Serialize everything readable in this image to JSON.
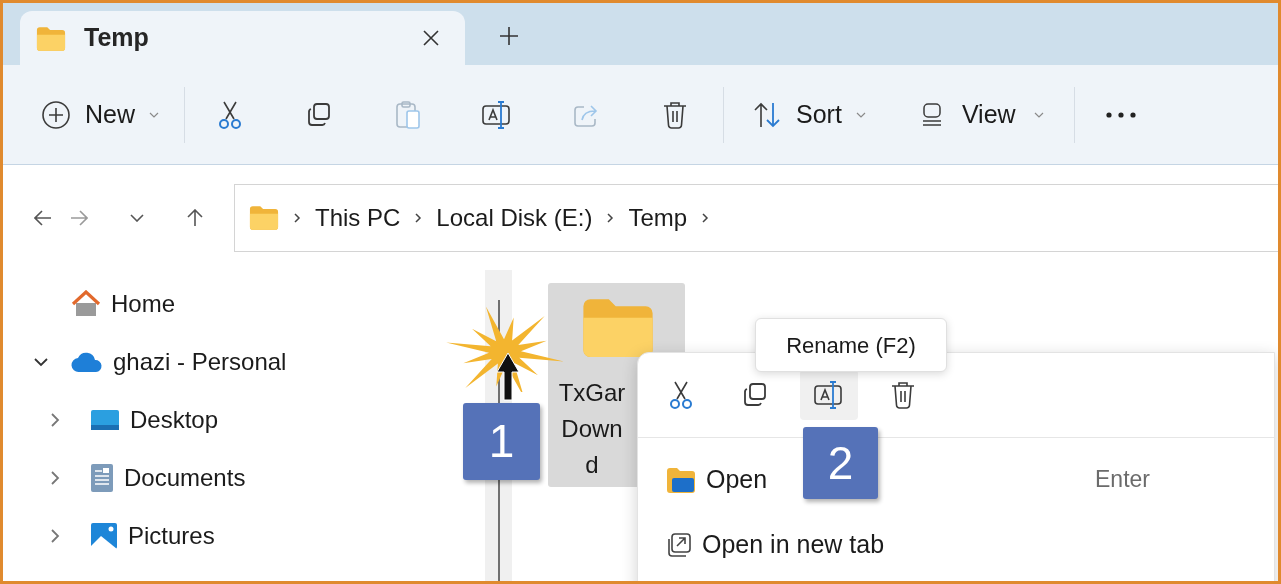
{
  "tabs": [
    {
      "label": "Temp",
      "selected": true
    }
  ],
  "toolbar": {
    "new_button": {
      "label": "New"
    },
    "icon_buttons": [
      {
        "kind": "cut",
        "disabled": false
      },
      {
        "kind": "copy",
        "disabled": false
      },
      {
        "kind": "paste",
        "disabled": true
      },
      {
        "kind": "rename",
        "disabled": false
      },
      {
        "kind": "share",
        "disabled": true
      },
      {
        "kind": "delete",
        "disabled": false
      }
    ],
    "sort_button": {
      "label": "Sort"
    },
    "view_button": {
      "label": "View"
    }
  },
  "address_bar": {
    "segments": [
      "This PC",
      "Local Disk (E:)",
      "Temp"
    ]
  },
  "nav_pane": {
    "items": [
      {
        "kind": "home",
        "label": "Home"
      },
      {
        "kind": "cloud",
        "label": "ghazi - Personal",
        "expanded": true,
        "children": [
          {
            "kind": "desktop",
            "label": "Desktop",
            "expanded": false
          },
          {
            "kind": "documents",
            "label": "Documents",
            "expanded": false
          },
          {
            "kind": "pictures",
            "label": "Pictures",
            "expanded": false
          }
        ]
      }
    ]
  },
  "files": [
    {
      "name_lines": [
        "TxGar",
        "Down",
        "d"
      ],
      "selected": true
    }
  ],
  "context_menu": {
    "quick_actions": [
      {
        "kind": "cut",
        "hovered": false
      },
      {
        "kind": "copy",
        "hovered": false
      },
      {
        "kind": "rename",
        "hovered": true
      },
      {
        "kind": "delete",
        "hovered": false
      }
    ],
    "items": [
      {
        "kind": "open",
        "label": "Open",
        "shortcut": "Enter"
      },
      {
        "kind": "open_tab",
        "label": "Open in new tab"
      }
    ]
  },
  "tooltip": "Rename (F2)",
  "callouts": [
    "1",
    "2"
  ]
}
